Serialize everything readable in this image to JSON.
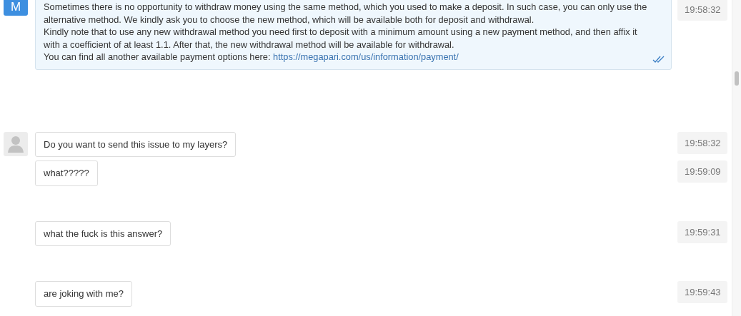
{
  "messages": [
    {
      "avatar": {
        "kind": "letter",
        "letter": "M"
      },
      "lines": [
        "Sometimes there is no opportunity to withdraw money using the same method, which you used to make a deposit. In such case, you can only use the alternative method. We kindly ask you to choose the new method, which will be available both for deposit and withdrawal.",
        "Kindly note that to use any new withdrawal method you need first to deposit with a minimum amount using a new payment method, and then affix it with a coefficient of at least 1.1. After that, the new withdrawal method will be available for withdrawal."
      ],
      "link_prefix": "You can find all another available payment options here:",
      "link": "https://megapari.com/us/information/payment/",
      "read": true,
      "time": "19:58:32"
    },
    {
      "avatar": {
        "kind": "silhouette"
      },
      "lines": [
        "Do you want to send this issue to my layers?"
      ],
      "time": "19:58:32"
    },
    {
      "lines": [
        "what?????"
      ],
      "time": "19:59:09"
    },
    {
      "lines": [
        "what the fuck is this answer?"
      ],
      "time": "19:59:31"
    },
    {
      "lines": [
        "are joking with me?"
      ],
      "time": "19:59:43"
    }
  ]
}
